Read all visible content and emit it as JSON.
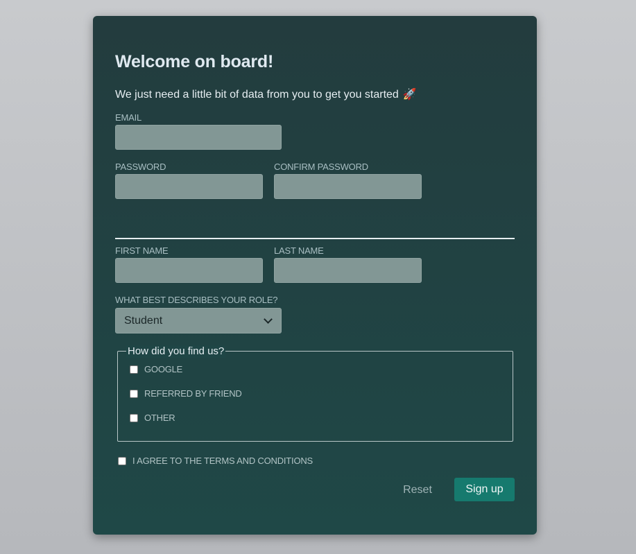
{
  "form": {
    "title": "Welcome on board!",
    "subtitle": "We just need a little bit of data from you to get you started",
    "subtitle_icon": "rocket-emoji",
    "email": {
      "label": "EMAIL",
      "value": ""
    },
    "password": {
      "label": "PASSWORD",
      "value": ""
    },
    "confirm_password": {
      "label": "CONFIRM PASSWORD",
      "value": ""
    },
    "first_name": {
      "label": "FIRST NAME",
      "value": ""
    },
    "last_name": {
      "label": "LAST NAME",
      "value": ""
    },
    "role": {
      "label": "WHAT BEST DESCRIBES YOUR ROLE?",
      "selected": "Student"
    },
    "referral": {
      "legend": "How did you find us?",
      "options": [
        {
          "label": "GOOGLE",
          "checked": false
        },
        {
          "label": "REFERRED BY FRIEND",
          "checked": false
        },
        {
          "label": "OTHER",
          "checked": false
        }
      ]
    },
    "terms": {
      "label": "I AGREE TO THE TERMS AND CONDITIONS",
      "checked": false
    },
    "buttons": {
      "reset": "Reset",
      "signup": "Sign up"
    }
  },
  "colors": {
    "card_background": "#1f4847",
    "input_background": "#829795",
    "primary_button": "#167a6e"
  }
}
